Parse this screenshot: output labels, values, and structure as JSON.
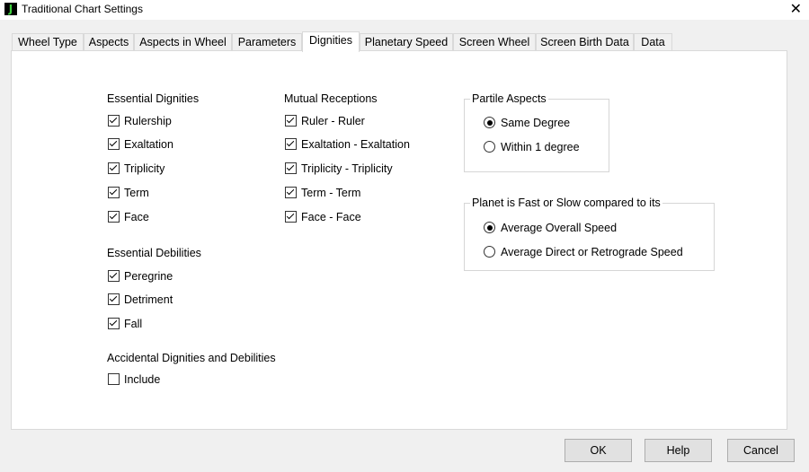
{
  "window": {
    "title": "Traditional Chart Settings",
    "icon_letter": "J",
    "close_glyph": "✕"
  },
  "tabs": [
    {
      "label": "Wheel Type"
    },
    {
      "label": "Aspects"
    },
    {
      "label": "Aspects in Wheel"
    },
    {
      "label": "Parameters"
    },
    {
      "label": "Dignities",
      "active": true
    },
    {
      "label": "Planetary Speed"
    },
    {
      "label": "Screen Wheel"
    },
    {
      "label": "Screen Birth Data"
    },
    {
      "label": "Data"
    }
  ],
  "essential_dignities": {
    "label": "Essential Dignities",
    "items": [
      {
        "label": "Rulership",
        "checked": true
      },
      {
        "label": "Exaltation",
        "checked": true
      },
      {
        "label": "Triplicity",
        "checked": true
      },
      {
        "label": "Term",
        "checked": true
      },
      {
        "label": "Face",
        "checked": true
      }
    ]
  },
  "essential_debilities": {
    "label": "Essential Debilities",
    "items": [
      {
        "label": "Peregrine",
        "checked": true
      },
      {
        "label": "Detriment",
        "checked": true
      },
      {
        "label": "Fall",
        "checked": true
      }
    ]
  },
  "accidental": {
    "label": "Accidental Dignities and Debilities",
    "items": [
      {
        "label": "Include",
        "checked": false
      }
    ]
  },
  "mutual_receptions": {
    "label": "Mutual Receptions",
    "items": [
      {
        "label": "Ruler - Ruler",
        "checked": true
      },
      {
        "label": "Exaltation - Exaltation",
        "checked": true
      },
      {
        "label": "Triplicity - Triplicity",
        "checked": true
      },
      {
        "label": "Term - Term",
        "checked": true
      },
      {
        "label": "Face - Face",
        "checked": true
      }
    ]
  },
  "partile_aspects": {
    "label": "Partile Aspects",
    "options": [
      {
        "label": "Same Degree",
        "selected": true
      },
      {
        "label": "Within 1 degree",
        "selected": false
      }
    ]
  },
  "planet_speed": {
    "label": "Planet is Fast or Slow compared to its",
    "options": [
      {
        "label": "Average Overall Speed",
        "selected": true
      },
      {
        "label": "Average Direct or Retrograde Speed",
        "selected": false
      }
    ]
  },
  "buttons": {
    "ok": "OK",
    "help": "Help",
    "cancel": "Cancel"
  }
}
